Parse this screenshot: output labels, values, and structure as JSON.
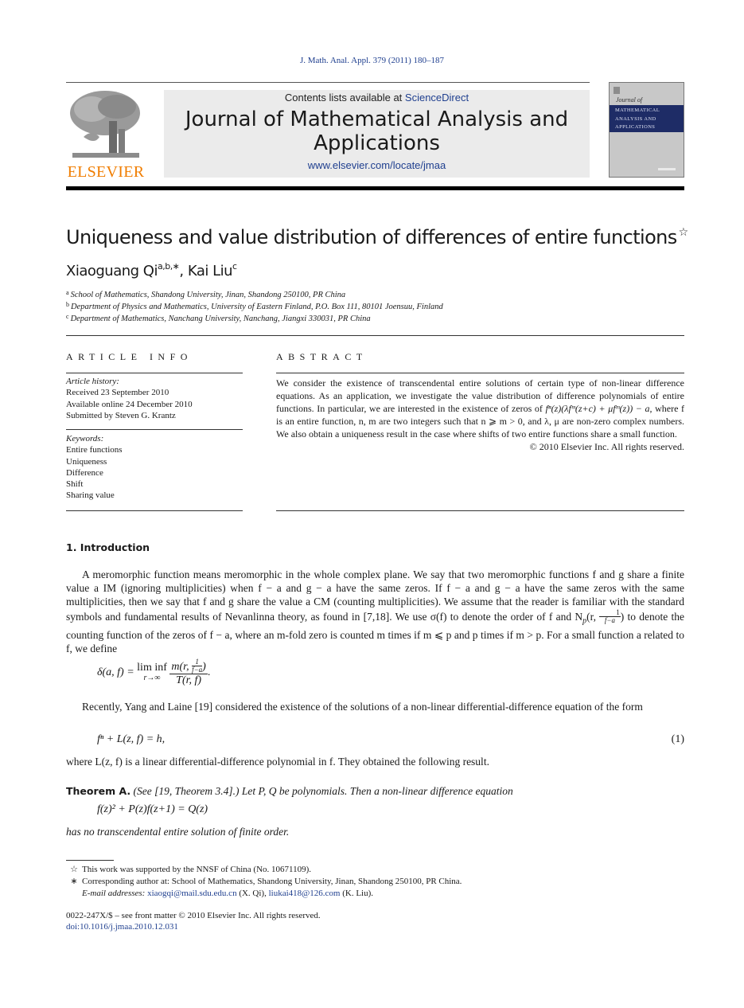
{
  "header": {
    "citation": "J. Math. Anal. Appl. 379 (2011) 180–187",
    "publisher_logo_text": "ELSEVIER",
    "contents_prefix": "Contents lists available at ",
    "contents_link": "ScienceDirect",
    "journal_title_line1": "Journal of Mathematical Analysis and",
    "journal_title_line2": "Applications",
    "journal_url": "www.elsevier.com/locate/jmaa",
    "cover": {
      "small_title": "Journal of",
      "band_lines": [
        "MATHEMATICAL",
        "ANALYSIS AND",
        "APPLICATIONS"
      ]
    },
    "colors": {
      "link": "#1f3f8f",
      "elsevier_orange": "#f07d00",
      "cover_band": "#1e2c66",
      "masthead_bg": "#ebebeb"
    }
  },
  "article": {
    "title": "Uniqueness and value distribution of differences of entire functions",
    "title_mark": "☆",
    "authors": [
      {
        "name": "Xiaoguang Qi",
        "marks": "a,b,∗"
      },
      {
        "name": "Kai Liu",
        "marks": "c"
      }
    ],
    "author_separator": ", ",
    "affiliations": [
      {
        "mark": "a",
        "text": "School of Mathematics, Shandong University, Jinan, Shandong 250100, PR China"
      },
      {
        "mark": "b",
        "text": "Department of Physics and Mathematics, University of Eastern Finland, P.O. Box 111, 80101 Joensuu, Finland"
      },
      {
        "mark": "c",
        "text": "Department of Mathematics, Nanchang University, Nanchang, Jiangxi 330031, PR China"
      }
    ]
  },
  "article_info": {
    "heading": "ARTICLE INFO",
    "history_label": "Article history:",
    "history": [
      "Received 23 September 2010",
      "Available online 24 December 2010",
      "Submitted by Steven G. Krantz"
    ],
    "keywords_label": "Keywords:",
    "keywords": [
      "Entire functions",
      "Uniqueness",
      "Difference",
      "Shift",
      "Sharing value"
    ]
  },
  "abstract": {
    "heading": "ABSTRACT",
    "p1": "We consider the existence of transcendental entire solutions of certain type of non-linear difference equations. As an application, we investigate the value distribution of difference polynomials of entire functions. In particular, we are interested in the existence of zeros of ",
    "expr": "fⁿ(z)(λfᵐ(z+c) + μfᵐ(z)) − a",
    "p2": ", where f is an entire function, n, m are two integers such that n ⩾ m > 0, and λ, μ are non-zero complex numbers. We also obtain a uniqueness result in the case where shifts of two entire functions share a small function.",
    "copyright": "© 2010 Elsevier Inc. All rights reserved."
  },
  "introduction": {
    "heading": "1. Introduction",
    "para1_a": "A meromorphic function means meromorphic in the whole complex plane. We say that two meromorphic functions f and g share a finite value a IM (ignoring multiplicities) when f − a and g − a have the same zeros. If f − a and g − a have the same zeros with the same multiplicities, then we say that f and g share the value a CM (counting multiplicities). We assume that the reader is familiar with the standard symbols and fundamental results of Nevanlinna theory, as found in [7,18]. We use σ(f) to denote the order of f and N",
    "para1_sub": "p",
    "para1_b": "(r, ",
    "para1_frac_num": "1",
    "para1_frac_den": "f−a",
    "para1_c": ") to denote the counting function of the zeros of f − a, where an m-fold zero is counted m times if m ⩽ p and p times if m > p. For a small function a related to f, we define",
    "eq_delta_lhs": "δ(a, f) = ",
    "eq_delta_lim": "lim inf",
    "eq_delta_limsub": "r→∞",
    "eq_delta_num_a": "m(r, ",
    "eq_delta_num_frac_num": "1",
    "eq_delta_num_frac_den": "f−a",
    "eq_delta_num_b": ")",
    "eq_delta_den": "T(r, f)",
    "eq_delta_end": ".",
    "para2": "Recently, Yang and Laine [19] considered the existence of the solutions of a non-linear differential-difference equation of the form",
    "eq1": "fⁿ + L(z, f) = h,",
    "eq1_number": "(1)",
    "para3": "where L(z, f) is a linear differential-difference polynomial in f. They obtained the following result.",
    "theorem_label": "Theorem A.",
    "theorem_text": " (See [19, Theorem 3.4].) Let P, Q be polynomials. Then a non-linear difference equation",
    "theorem_eq": "f(z)² + P(z)f(z+1) = Q(z)",
    "theorem_conclusion": "has no transcendental entire solution of finite order."
  },
  "footnotes": {
    "star_mark": "☆",
    "star_text": "This work was supported by the NNSF of China (No. 10671109).",
    "corr_mark": "∗",
    "corr_text": "Corresponding author at: School of Mathematics, Shandong University, Jinan, Shandong 250100, PR China.",
    "email_label": "E-mail addresses: ",
    "email1": "xiaogqi@mail.sdu.edu.cn",
    "email1_who": " (X. Qi), ",
    "email2": "liukai418@126.com",
    "email2_who": " (K. Liu)."
  },
  "bottom": {
    "front_matter": "0022-247X/$ – see front matter  © 2010 Elsevier Inc. All rights reserved.",
    "doi": "doi:10.1016/j.jmaa.2010.12.031"
  }
}
